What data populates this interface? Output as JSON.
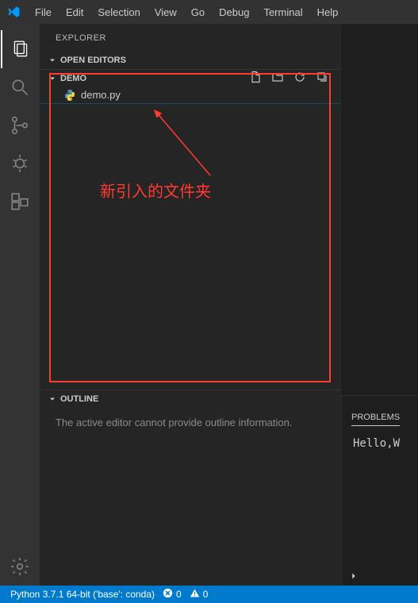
{
  "menu": {
    "items": [
      "File",
      "Edit",
      "Selection",
      "View",
      "Go",
      "Debug",
      "Terminal",
      "Help"
    ]
  },
  "sidebar": {
    "title": "EXPLORER",
    "openEditors": "OPEN EDITORS",
    "folderName": "DEMO",
    "file": "demo.py",
    "outline": "OUTLINE",
    "outlineMsg": "The active editor cannot provide outline information."
  },
  "annotation": {
    "label": "新引入的文件夹"
  },
  "panel": {
    "tab": "PROBLEMS",
    "output": "Hello,W"
  },
  "status": {
    "python": "Python 3.7.1 64-bit ('base': conda)",
    "errors": "0",
    "warnings": "0"
  }
}
